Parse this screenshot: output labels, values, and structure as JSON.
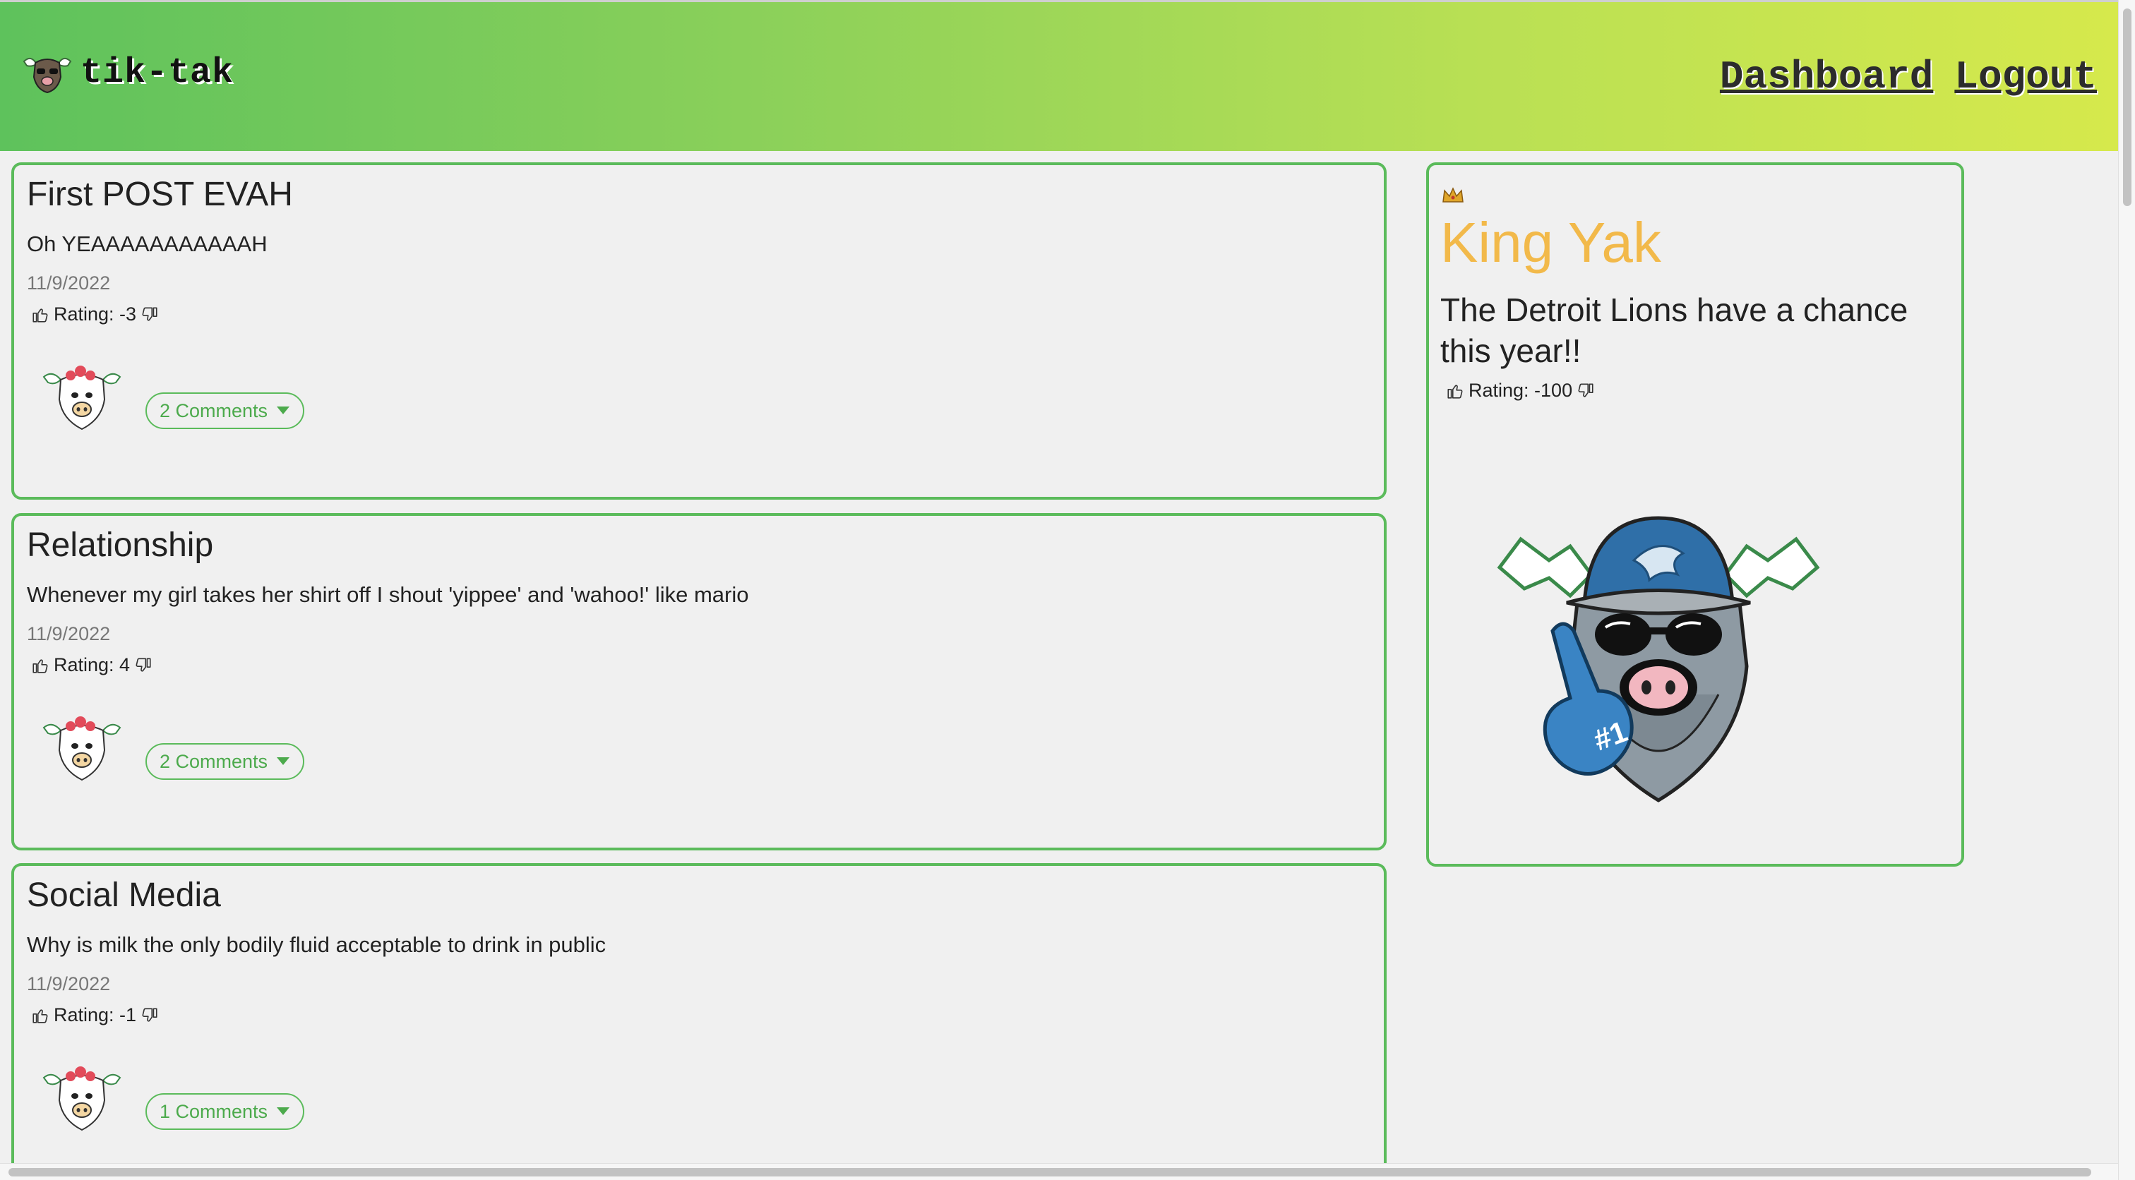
{
  "app": {
    "name": "tik-tak",
    "logo_icon": "yak-logo-icon"
  },
  "nav": {
    "dashboard": "Dashboard",
    "logout": "Logout"
  },
  "posts": [
    {
      "title": "First POST EVAH",
      "body": "Oh YEAAAAAAAAAAAH",
      "date": "11/9/2022",
      "rating_label": "Rating: -3",
      "comments_label": "2 Comments"
    },
    {
      "title": "Relationship",
      "body": "Whenever my girl takes her shirt off I shout 'yippee' and 'wahoo!' like mario",
      "date": "11/9/2022",
      "rating_label": "Rating: 4",
      "comments_label": "2 Comments"
    },
    {
      "title": "Social Media",
      "body": "Why is milk the only bodily fluid acceptable to drink in public",
      "date": "11/9/2022",
      "rating_label": "Rating: -1",
      "comments_label": "1 Comments"
    }
  ],
  "king_yak": {
    "crown_icon": "crown-icon",
    "title": "King Yak",
    "body": "The Detroit Lions have a chance this year!!",
    "rating_label": "Rating: -100"
  },
  "colors": {
    "accent_green": "#5bbb5b",
    "king_title": "#f2b94a",
    "header_gradient_start": "#5ec25c",
    "header_gradient_end": "#d6e94c"
  }
}
